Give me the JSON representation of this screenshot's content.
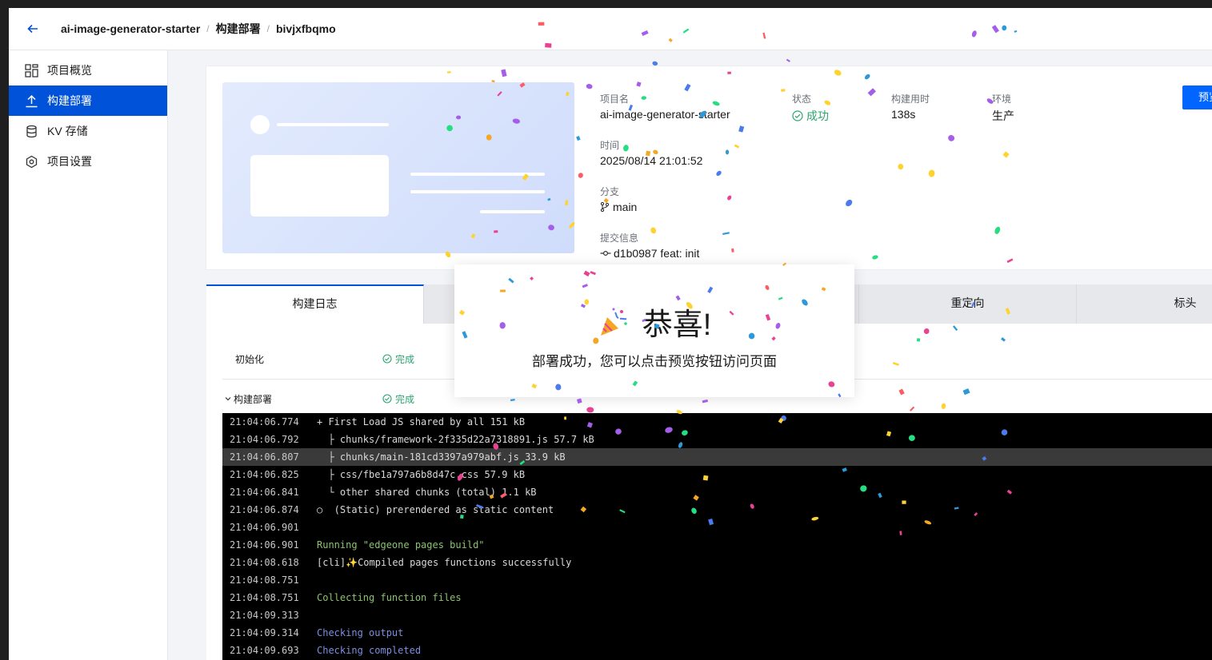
{
  "header": {
    "breadcrumbs": [
      "ai-image-generator-starter",
      "构建部署",
      "bivjxfbqmo"
    ],
    "separator": "/"
  },
  "sidebar": {
    "items": [
      {
        "label": "项目概览",
        "icon": "overview-icon",
        "active": false
      },
      {
        "label": "构建部署",
        "icon": "upload-icon",
        "active": true
      },
      {
        "label": "KV 存储",
        "icon": "database-icon",
        "active": false
      },
      {
        "label": "项目设置",
        "icon": "settings-icon",
        "active": false
      }
    ]
  },
  "deployment": {
    "project_label": "项目名",
    "project_value": "ai-image-generator-starter",
    "status_label": "状态",
    "status_value": "成功",
    "duration_label": "构建用时",
    "duration_value": "138s",
    "env_label": "环境",
    "env_value": "生产",
    "time_label": "时间",
    "time_value": "2025/08/14 21:01:52",
    "branch_label": "分支",
    "branch_value": "main",
    "commit_label": "提交信息",
    "commit_value": "d1b0987 feat: init",
    "preview_button": "预览"
  },
  "tabs": [
    "构建日志",
    "",
    "",
    "",
    "重定向",
    "标头"
  ],
  "steps": [
    {
      "name": "初始化",
      "status": "完成"
    },
    {
      "name": "构建部署",
      "status": "完成"
    }
  ],
  "log": [
    {
      "time": "21:04:06.774",
      "text": "+ First Load JS shared by all 151 kB",
      "style": ""
    },
    {
      "time": "21:04:06.792",
      "text": "  ├ chunks/framework-2f335d22a7318891.js 57.7 kB",
      "style": ""
    },
    {
      "time": "21:04:06.807",
      "text": "  ├ chunks/main-181cd3397a979abf.js 33.9 kB",
      "style": "hl"
    },
    {
      "time": "21:04:06.825",
      "text": "  ├ css/fbe1a797a6b8d47c.css 57.9 kB",
      "style": ""
    },
    {
      "time": "21:04:06.841",
      "text": "  └ other shared chunks (total) 1.1 kB",
      "style": ""
    },
    {
      "time": "21:04:06.874",
      "text": "○  (Static) prerendered as static content",
      "style": ""
    },
    {
      "time": "21:04:06.901",
      "text": "",
      "style": ""
    },
    {
      "time": "21:04:06.901",
      "text": "Running \"edgeone pages build\"",
      "style": "green"
    },
    {
      "time": "21:04:08.618",
      "text": "[cli]✨Compiled pages functions successfully",
      "style": ""
    },
    {
      "time": "21:04:08.751",
      "text": "",
      "style": ""
    },
    {
      "time": "21:04:08.751",
      "text": "Collecting function files",
      "style": "green"
    },
    {
      "time": "21:04:09.313",
      "text": "",
      "style": ""
    },
    {
      "time": "21:04:09.314",
      "text": "Checking output",
      "style": "blue"
    },
    {
      "time": "21:04:09.693",
      "text": "Checking completed",
      "style": "blue"
    }
  ],
  "modal": {
    "title": "恭喜!",
    "message": "部署成功，您可以点击预览按钮访问页面"
  },
  "colors": {
    "primary": "#0052d9",
    "success": "#2ba471",
    "confetti": [
      "#e84393",
      "#f5a623",
      "#a55eea",
      "#2d98da",
      "#26de81",
      "#fed330",
      "#fc5c65",
      "#4b7bec"
    ]
  }
}
